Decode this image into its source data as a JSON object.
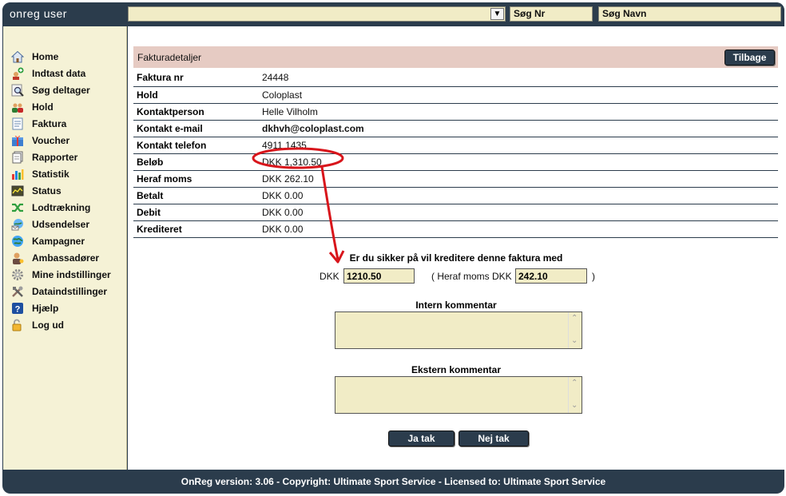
{
  "app": {
    "title": "onreg user"
  },
  "topbar": {
    "select_value": "",
    "search_nr_label": "Søg Nr",
    "search_navn_label": "Søg Navn"
  },
  "sidebar": {
    "items": [
      {
        "label": "Home",
        "icon": "home-icon"
      },
      {
        "label": "Indtast data",
        "icon": "add-person-icon"
      },
      {
        "label": "Søg deltager",
        "icon": "magnifier-icon"
      },
      {
        "label": "Hold",
        "icon": "group-icon"
      },
      {
        "label": "Faktura",
        "icon": "document-icon"
      },
      {
        "label": "Voucher",
        "icon": "gift-icon"
      },
      {
        "label": "Rapporter",
        "icon": "report-icon"
      },
      {
        "label": "Statistik",
        "icon": "bar-chart-icon"
      },
      {
        "label": "Status",
        "icon": "status-monitor-icon"
      },
      {
        "label": "Lodtrækning",
        "icon": "shuffle-icon"
      },
      {
        "label": "Udsendelser",
        "icon": "mail-globe-icon"
      },
      {
        "label": "Kampagner",
        "icon": "globe-icon"
      },
      {
        "label": "Ambassadører",
        "icon": "person-badge-icon"
      },
      {
        "label": "Mine indstillinger",
        "icon": "gear-icon"
      },
      {
        "label": "Dataindstillinger",
        "icon": "tools-icon"
      },
      {
        "label": "Hjælp",
        "icon": "help-icon"
      },
      {
        "label": "Log ud",
        "icon": "padlock-icon"
      }
    ]
  },
  "details": {
    "title": "Fakturadetaljer",
    "back_label": "Tilbage",
    "rows": [
      {
        "key": "Faktura nr",
        "value": "24448"
      },
      {
        "key": "Hold",
        "value": "Coloplast"
      },
      {
        "key": "Kontaktperson",
        "value": "Helle Vilholm"
      },
      {
        "key": "Kontakt e-mail",
        "value": "dkhvh@coloplast.com"
      },
      {
        "key": "Kontakt telefon",
        "value": "4911 1435"
      },
      {
        "key": "Beløb",
        "value": "DKK 1,310.50"
      },
      {
        "key": "Heraf moms",
        "value": "DKK 262.10"
      },
      {
        "key": "Betalt",
        "value": "DKK 0.00"
      },
      {
        "key": "Debit",
        "value": "DKK 0.00"
      },
      {
        "key": "Krediteret",
        "value": "DKK 0.00"
      }
    ]
  },
  "credit": {
    "question": "Er du sikker på vil kreditere denne faktura med",
    "currency_label": "DKK",
    "amount_value": "1210.50",
    "vat_label_prefix": "( Heraf moms DKK",
    "vat_value": "242.10",
    "vat_label_suffix": ")"
  },
  "comments": {
    "internal_label": "Intern kommentar",
    "internal_value": "",
    "external_label": "Ekstern kommentar",
    "external_value": ""
  },
  "actions": {
    "yes_label": "Ja tak",
    "no_label": "Nej tak"
  },
  "footer": {
    "text": "OnReg version: 3.06 - Copyright: Ultimate Sport Service - Licensed to: Ultimate Sport Service"
  },
  "colors": {
    "frame": "#2b3c4c",
    "sidebar_bg": "#f5f2d6",
    "input_bg": "#f1ecc6",
    "header_band": "#e6cbc3",
    "annotation_red": "#d8151b"
  }
}
